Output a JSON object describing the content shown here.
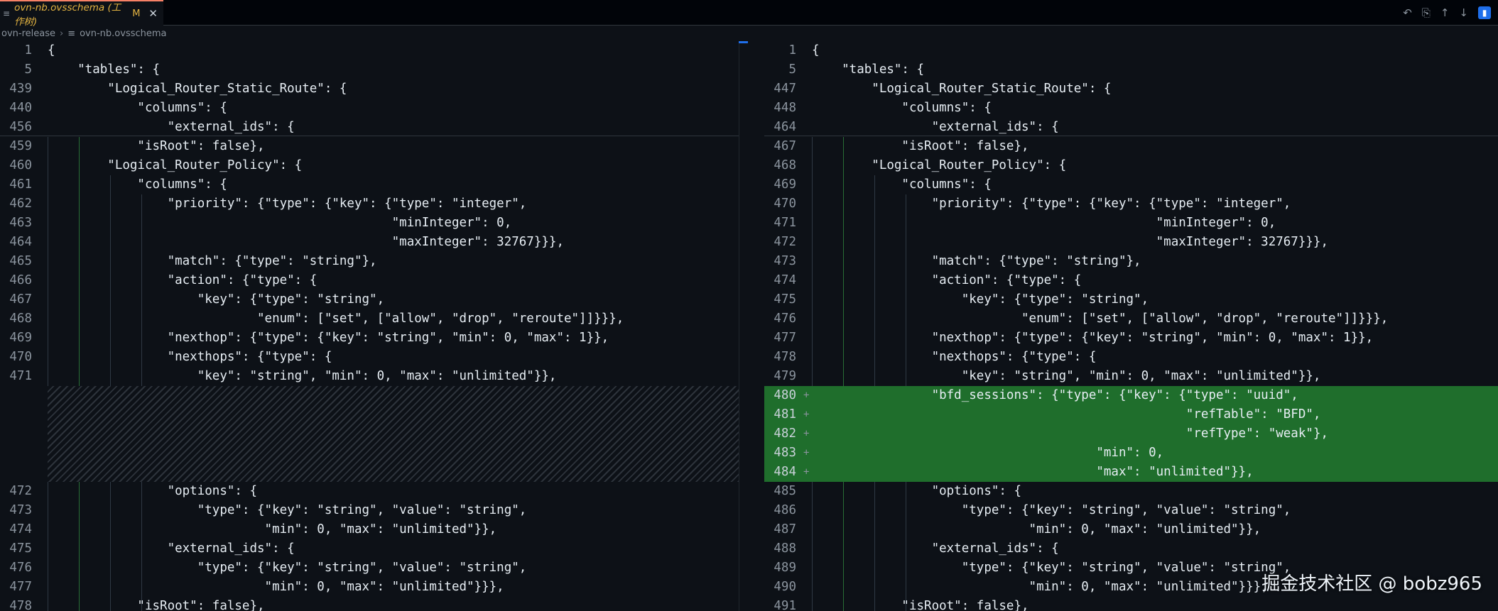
{
  "tab": {
    "title": "ovn-nb.ovsschema (工作树)",
    "modified": "M",
    "close": "✕"
  },
  "actions": [
    "↶",
    "⎘",
    "↑",
    "↓",
    "▮"
  ],
  "breadcrumb": {
    "folder": "ovn-release",
    "file": "ovn-nb.ovsschema"
  },
  "left": {
    "lines": [
      {
        "n": "1",
        "t": "{"
      },
      {
        "n": "5",
        "t": "    \"tables\": {"
      },
      {
        "n": "439",
        "t": "        \"Logical_Router_Static_Route\": {"
      },
      {
        "n": "440",
        "t": "            \"columns\": {"
      },
      {
        "n": "456",
        "t": "                \"external_ids\": {"
      },
      {
        "n": "459",
        "t": "            \"isRoot\": false},"
      },
      {
        "n": "460",
        "t": "        \"Logical_Router_Policy\": {"
      },
      {
        "n": "461",
        "t": "            \"columns\": {"
      },
      {
        "n": "462",
        "t": "                \"priority\": {\"type\": {\"key\": {\"type\": \"integer\","
      },
      {
        "n": "463",
        "t": "                                              \"minInteger\": 0,"
      },
      {
        "n": "464",
        "t": "                                              \"maxInteger\": 32767}}},"
      },
      {
        "n": "465",
        "t": "                \"match\": {\"type\": \"string\"},"
      },
      {
        "n": "466",
        "t": "                \"action\": {\"type\": {"
      },
      {
        "n": "467",
        "t": "                    \"key\": {\"type\": \"string\","
      },
      {
        "n": "468",
        "t": "                            \"enum\": [\"set\", [\"allow\", \"drop\", \"reroute\"]]}}},"
      },
      {
        "n": "469",
        "t": "                \"nexthop\": {\"type\": {\"key\": \"string\", \"min\": 0, \"max\": 1}},"
      },
      {
        "n": "470",
        "t": "                \"nexthops\": {\"type\": {"
      },
      {
        "n": "471",
        "t": "                    \"key\": \"string\", \"min\": 0, \"max\": \"unlimited\"}},"
      },
      {
        "n": "472",
        "t": "                \"options\": {"
      },
      {
        "n": "473",
        "t": "                    \"type\": {\"key\": \"string\", \"value\": \"string\","
      },
      {
        "n": "474",
        "t": "                             \"min\": 0, \"max\": \"unlimited\"}},"
      },
      {
        "n": "475",
        "t": "                \"external_ids\": {"
      },
      {
        "n": "476",
        "t": "                    \"type\": {\"key\": \"string\", \"value\": \"string\","
      },
      {
        "n": "477",
        "t": "                             \"min\": 0, \"max\": \"unlimited\"}}},"
      },
      {
        "n": "478",
        "t": "            \"isRoot\": false},"
      }
    ]
  },
  "right": {
    "lines": [
      {
        "n": "1",
        "t": "{"
      },
      {
        "n": "5",
        "t": "    \"tables\": {"
      },
      {
        "n": "447",
        "t": "        \"Logical_Router_Static_Route\": {"
      },
      {
        "n": "448",
        "t": "            \"columns\": {"
      },
      {
        "n": "464",
        "t": "                \"external_ids\": {"
      },
      {
        "n": "467",
        "t": "            \"isRoot\": false},"
      },
      {
        "n": "468",
        "t": "        \"Logical_Router_Policy\": {"
      },
      {
        "n": "469",
        "t": "            \"columns\": {"
      },
      {
        "n": "470",
        "t": "                \"priority\": {\"type\": {\"key\": {\"type\": \"integer\","
      },
      {
        "n": "471",
        "t": "                                              \"minInteger\": 0,"
      },
      {
        "n": "472",
        "t": "                                              \"maxInteger\": 32767}}},"
      },
      {
        "n": "473",
        "t": "                \"match\": {\"type\": \"string\"},"
      },
      {
        "n": "474",
        "t": "                \"action\": {\"type\": {"
      },
      {
        "n": "475",
        "t": "                    \"key\": {\"type\": \"string\","
      },
      {
        "n": "476",
        "t": "                            \"enum\": [\"set\", [\"allow\", \"drop\", \"reroute\"]]}}},"
      },
      {
        "n": "477",
        "t": "                \"nexthop\": {\"type\": {\"key\": \"string\", \"min\": 0, \"max\": 1}},"
      },
      {
        "n": "478",
        "t": "                \"nexthops\": {\"type\": {"
      },
      {
        "n": "479",
        "t": "                    \"key\": \"string\", \"min\": 0, \"max\": \"unlimited\"}},"
      },
      {
        "n": "480",
        "t": "                \"bfd_sessions\": {\"type\": {\"key\": {\"type\": \"uuid\",",
        "added": true
      },
      {
        "n": "481",
        "t": "                                                  \"refTable\": \"BFD\",",
        "added": true
      },
      {
        "n": "482",
        "t": "                                                  \"refType\": \"weak\"},",
        "added": true
      },
      {
        "n": "483",
        "t": "                                      \"min\": 0,",
        "added": true
      },
      {
        "n": "484",
        "t": "                                      \"max\": \"unlimited\"}},",
        "added": true
      },
      {
        "n": "485",
        "t": "                \"options\": {"
      },
      {
        "n": "486",
        "t": "                    \"type\": {\"key\": \"string\", \"value\": \"string\","
      },
      {
        "n": "487",
        "t": "                             \"min\": 0, \"max\": \"unlimited\"}},"
      },
      {
        "n": "488",
        "t": "                \"external_ids\": {"
      },
      {
        "n": "489",
        "t": "                    \"type\": {\"key\": \"string\", \"value\": \"string\","
      },
      {
        "n": "490",
        "t": "                             \"min\": 0, \"max\": \"unlimited\"}}},"
      },
      {
        "n": "491",
        "t": "            \"isRoot\": false},"
      }
    ]
  },
  "watermark": "掘金技术社区 @ bobz965",
  "colors": {
    "added_bg": "#1f6e2c",
    "tab_modified": "#e3b341",
    "accent": "#1f6feb"
  }
}
